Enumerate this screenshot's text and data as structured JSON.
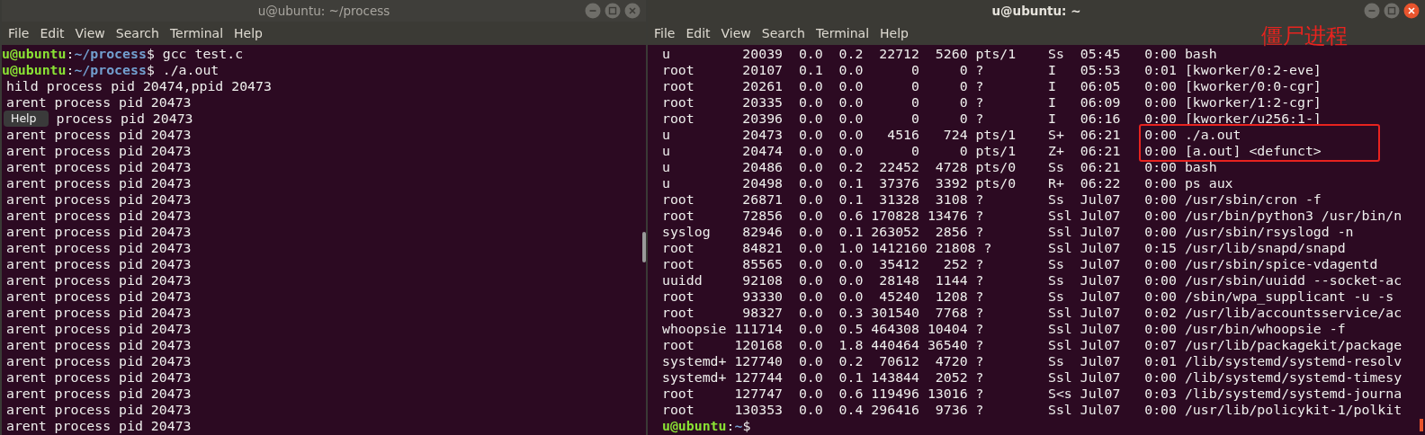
{
  "windows": [
    {
      "title": "u@ubuntu: ~/process",
      "focused": false,
      "menu": [
        "File",
        "Edit",
        "View",
        "Search",
        "Terminal",
        "Help"
      ],
      "lines": [
        {
          "kind": "prompt",
          "user": "u@ubuntu",
          "separator": ":",
          "path": "~/process",
          "sign": "$",
          "command": "gcc test.c"
        },
        {
          "kind": "prompt",
          "user": "u@ubuntu",
          "separator": ":",
          "path": "~/process",
          "sign": "$",
          "command": "./a.out"
        },
        {
          "kind": "output",
          "text": "hild process pid 20474,ppid 20473"
        },
        {
          "kind": "output",
          "text": "arent process pid 20473"
        },
        {
          "kind": "covered",
          "tooltip": "Help",
          "text": "process pid 20473"
        },
        {
          "kind": "output",
          "text": "arent process pid 20473"
        },
        {
          "kind": "output",
          "text": "arent process pid 20473"
        },
        {
          "kind": "output",
          "text": "arent process pid 20473"
        },
        {
          "kind": "output",
          "text": "arent process pid 20473"
        },
        {
          "kind": "output",
          "text": "arent process pid 20473"
        },
        {
          "kind": "output",
          "text": "arent process pid 20473"
        },
        {
          "kind": "output",
          "text": "arent process pid 20473"
        },
        {
          "kind": "output",
          "text": "arent process pid 20473"
        },
        {
          "kind": "output",
          "text": "arent process pid 20473"
        },
        {
          "kind": "output",
          "text": "arent process pid 20473"
        },
        {
          "kind": "output",
          "text": "arent process pid 20473"
        },
        {
          "kind": "output",
          "text": "arent process pid 20473"
        },
        {
          "kind": "output",
          "text": "arent process pid 20473"
        },
        {
          "kind": "output",
          "text": "arent process pid 20473"
        },
        {
          "kind": "output",
          "text": "arent process pid 20473"
        },
        {
          "kind": "output",
          "text": "arent process pid 20473"
        },
        {
          "kind": "output",
          "text": "arent process pid 20473"
        },
        {
          "kind": "output",
          "text": "arent process pid 20473"
        },
        {
          "kind": "output",
          "text": "arent process pid 20473"
        }
      ]
    },
    {
      "title": "u@ubuntu: ~",
      "focused": true,
      "menu": [
        "File",
        "Edit",
        "View",
        "Search",
        "Terminal",
        "Help"
      ],
      "annotation": "僵尸进程",
      "lines": [
        {
          "kind": "process",
          "highlighted": false,
          "fields": [
            "u",
            "20039",
            "0.0",
            "0.2",
            "22712",
            "5260",
            "pts/1",
            "Ss",
            "05:45",
            "0:00",
            "bash"
          ]
        },
        {
          "kind": "process",
          "highlighted": false,
          "fields": [
            "root",
            "20107",
            "0.1",
            "0.0",
            "0",
            "0",
            "?",
            "I",
            "05:53",
            "0:01",
            "[kworker/0:2-eve]"
          ]
        },
        {
          "kind": "process",
          "highlighted": false,
          "fields": [
            "root",
            "20261",
            "0.0",
            "0.0",
            "0",
            "0",
            "?",
            "I",
            "06:05",
            "0:00",
            "[kworker/0:0-cgr]"
          ]
        },
        {
          "kind": "process",
          "highlighted": false,
          "fields": [
            "root",
            "20335",
            "0.0",
            "0.0",
            "0",
            "0",
            "?",
            "I",
            "06:09",
            "0:00",
            "[kworker/1:2-cgr]"
          ]
        },
        {
          "kind": "process",
          "highlighted": false,
          "fields": [
            "root",
            "20396",
            "0.0",
            "0.0",
            "0",
            "0",
            "?",
            "I",
            "06:16",
            "0:00",
            "[kworker/u256:1-]"
          ]
        },
        {
          "kind": "process",
          "highlighted": true,
          "fields": [
            "u",
            "20473",
            "0.0",
            "0.0",
            "4516",
            "724",
            "pts/1",
            "S+",
            "06:21",
            "0:00",
            "./a.out"
          ]
        },
        {
          "kind": "process",
          "highlighted": true,
          "fields": [
            "u",
            "20474",
            "0.0",
            "0.0",
            "0",
            "0",
            "pts/1",
            "Z+",
            "06:21",
            "0:00",
            "[a.out] <defunct>"
          ]
        },
        {
          "kind": "process",
          "highlighted": false,
          "fields": [
            "u",
            "20486",
            "0.0",
            "0.2",
            "22452",
            "4728",
            "pts/0",
            "Ss",
            "06:21",
            "0:00",
            "bash"
          ]
        },
        {
          "kind": "process",
          "highlighted": false,
          "fields": [
            "u",
            "20498",
            "0.0",
            "0.1",
            "37376",
            "3392",
            "pts/0",
            "R+",
            "06:22",
            "0:00",
            "ps aux"
          ]
        },
        {
          "kind": "process",
          "highlighted": false,
          "fields": [
            "root",
            "26871",
            "0.0",
            "0.1",
            "31328",
            "3108",
            "?",
            "Ss",
            "Jul07",
            "0:00",
            "/usr/sbin/cron -f"
          ]
        },
        {
          "kind": "process",
          "highlighted": false,
          "fields": [
            "root",
            "72856",
            "0.0",
            "0.6",
            "170828",
            "13476",
            "?",
            "Ssl",
            "Jul07",
            "0:00",
            "/usr/bin/python3 /usr/bin/n"
          ]
        },
        {
          "kind": "process",
          "highlighted": false,
          "fields": [
            "syslog",
            "82946",
            "0.0",
            "0.1",
            "263052",
            "2856",
            "?",
            "Ssl",
            "Jul07",
            "0:00",
            "/usr/sbin/rsyslogd -n"
          ]
        },
        {
          "kind": "process",
          "highlighted": false,
          "fields": [
            "root",
            "84821",
            "0.0",
            "1.0",
            "1412160",
            "21808",
            "?",
            "Ssl",
            "Jul07",
            "0:15",
            "/usr/lib/snapd/snapd"
          ]
        },
        {
          "kind": "process",
          "highlighted": false,
          "fields": [
            "root",
            "85565",
            "0.0",
            "0.0",
            "35412",
            "252",
            "?",
            "Ss",
            "Jul07",
            "0:00",
            "/usr/sbin/spice-vdagentd"
          ]
        },
        {
          "kind": "process",
          "highlighted": false,
          "fields": [
            "uuidd",
            "92108",
            "0.0",
            "0.0",
            "28148",
            "1144",
            "?",
            "Ss",
            "Jul07",
            "0:00",
            "/usr/sbin/uuidd --socket-ac"
          ]
        },
        {
          "kind": "process",
          "highlighted": false,
          "fields": [
            "root",
            "93330",
            "0.0",
            "0.0",
            "45240",
            "1208",
            "?",
            "Ss",
            "Jul07",
            "0:00",
            "/sbin/wpa_supplicant -u -s"
          ]
        },
        {
          "kind": "process",
          "highlighted": false,
          "fields": [
            "root",
            "98327",
            "0.0",
            "0.3",
            "301540",
            "7768",
            "?",
            "Ssl",
            "Jul07",
            "0:02",
            "/usr/lib/accountsservice/ac"
          ]
        },
        {
          "kind": "process",
          "highlighted": false,
          "fields": [
            "whoopsie",
            "111714",
            "0.0",
            "0.5",
            "464308",
            "10404",
            "?",
            "Ssl",
            "Jul07",
            "0:00",
            "/usr/bin/whoopsie -f"
          ]
        },
        {
          "kind": "process",
          "highlighted": false,
          "fields": [
            "root",
            "120168",
            "0.0",
            "1.8",
            "440464",
            "36540",
            "?",
            "Ssl",
            "Jul07",
            "0:07",
            "/usr/lib/packagekit/package"
          ]
        },
        {
          "kind": "process",
          "highlighted": false,
          "fields": [
            "systemd+",
            "127740",
            "0.0",
            "0.2",
            "70612",
            "4720",
            "?",
            "Ss",
            "Jul07",
            "0:01",
            "/lib/systemd/systemd-resolv"
          ]
        },
        {
          "kind": "process",
          "highlighted": false,
          "fields": [
            "systemd+",
            "127744",
            "0.0",
            "0.1",
            "143844",
            "2052",
            "?",
            "Ssl",
            "Jul07",
            "0:00",
            "/lib/systemd/systemd-timesy"
          ]
        },
        {
          "kind": "process",
          "highlighted": false,
          "fields": [
            "root",
            "127747",
            "0.0",
            "0.6",
            "119496",
            "13016",
            "?",
            "S<s",
            "Jul07",
            "0:03",
            "/lib/systemd/systemd-journa"
          ]
        },
        {
          "kind": "process",
          "highlighted": false,
          "fields": [
            "root",
            "130353",
            "0.0",
            "0.4",
            "296416",
            "9736",
            "?",
            "Ssl",
            "Jul07",
            "0:00",
            "/usr/lib/policykit-1/polkit"
          ]
        },
        {
          "kind": "prompt",
          "user": "u@ubuntu",
          "separator": ":",
          "path": "~",
          "sign": "$"
        }
      ]
    }
  ]
}
